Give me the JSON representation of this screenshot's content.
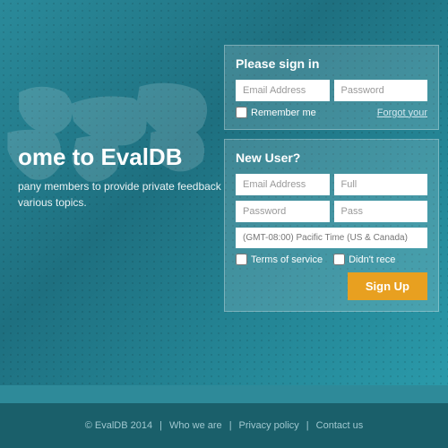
{
  "background": {
    "color": "#2e8a99"
  },
  "hero": {
    "title": "ome to EvalDB",
    "description": "pany members to provide private feedback\nvarious topics."
  },
  "signin": {
    "title": "Please sign in",
    "email_placeholder": "Email Address",
    "password_placeholder": "Password",
    "remember_label": "Remember me",
    "forgot_label": "Forgot your"
  },
  "newuser": {
    "title": "New User?",
    "email_placeholder": "Email Address",
    "fullname_placeholder": "Full",
    "password_placeholder": "Password",
    "password2_placeholder": "Pass",
    "timezone_placeholder": "(GMT-08:00) Pacific Time (US & Canada)",
    "terms_label": "Terms of service",
    "no_receive_label": "Didn't rece",
    "signup_button": "Sign Up"
  },
  "footer": {
    "copyright": "© EvalDB 2014",
    "who_we_are": "Who we are",
    "privacy_policy": "Privacy policy",
    "contact_us": "Contact us"
  }
}
